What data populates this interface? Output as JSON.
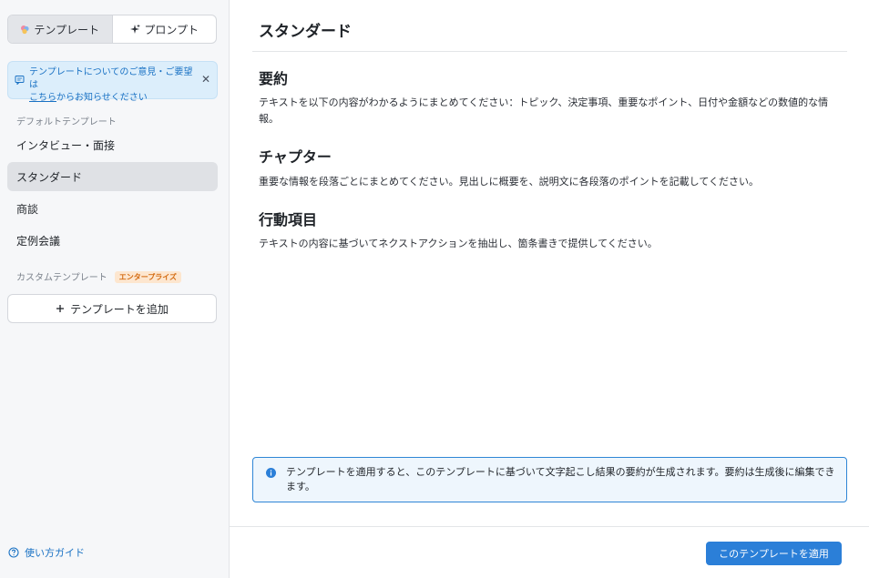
{
  "sidebar": {
    "tabs": [
      {
        "label": "テンプレート",
        "icon": "template-icon"
      },
      {
        "label": "プロンプト",
        "icon": "sparkle-icon"
      }
    ],
    "banner": {
      "text_before": "テンプレートについてのご意見・ご要望は",
      "link": "こちら",
      "text_after": "からお知らせください"
    },
    "default_label": "デフォルトテンプレート",
    "default_items": [
      "インタビュー・面接",
      "スタンダード",
      "商談",
      "定例会議"
    ],
    "custom_label": "カスタムテンプレート",
    "custom_badge": "エンタープライズ",
    "add_button": "テンプレートを追加",
    "guide_link": "使い方ガイド"
  },
  "main": {
    "title": "スタンダード",
    "sections": [
      {
        "heading": "要約",
        "body": "テキストを以下の内容がわかるようにまとめてください：トピック、決定事項、重要なポイント、日付や金額などの数値的な情報。"
      },
      {
        "heading": "チャプター",
        "body": "重要な情報を段落ごとにまとめてください。見出しに概要を、説明文に各段落のポイントを記載してください。"
      },
      {
        "heading": "行動項目",
        "body": "テキストの内容に基づいてネクストアクションを抽出し、箇条書きで提供してください。"
      }
    ],
    "info": "テンプレートを適用すると、このテンプレートに基づいて文字起こし結果の要約が生成されます。要約は生成後に編集できます。",
    "apply_button": "このテンプレートを適用"
  },
  "colors": {
    "accent": "#2b7fd8",
    "banner_bg": "#dceefb",
    "badge_bg": "#fde6cf",
    "badge_text": "#d36a10"
  }
}
